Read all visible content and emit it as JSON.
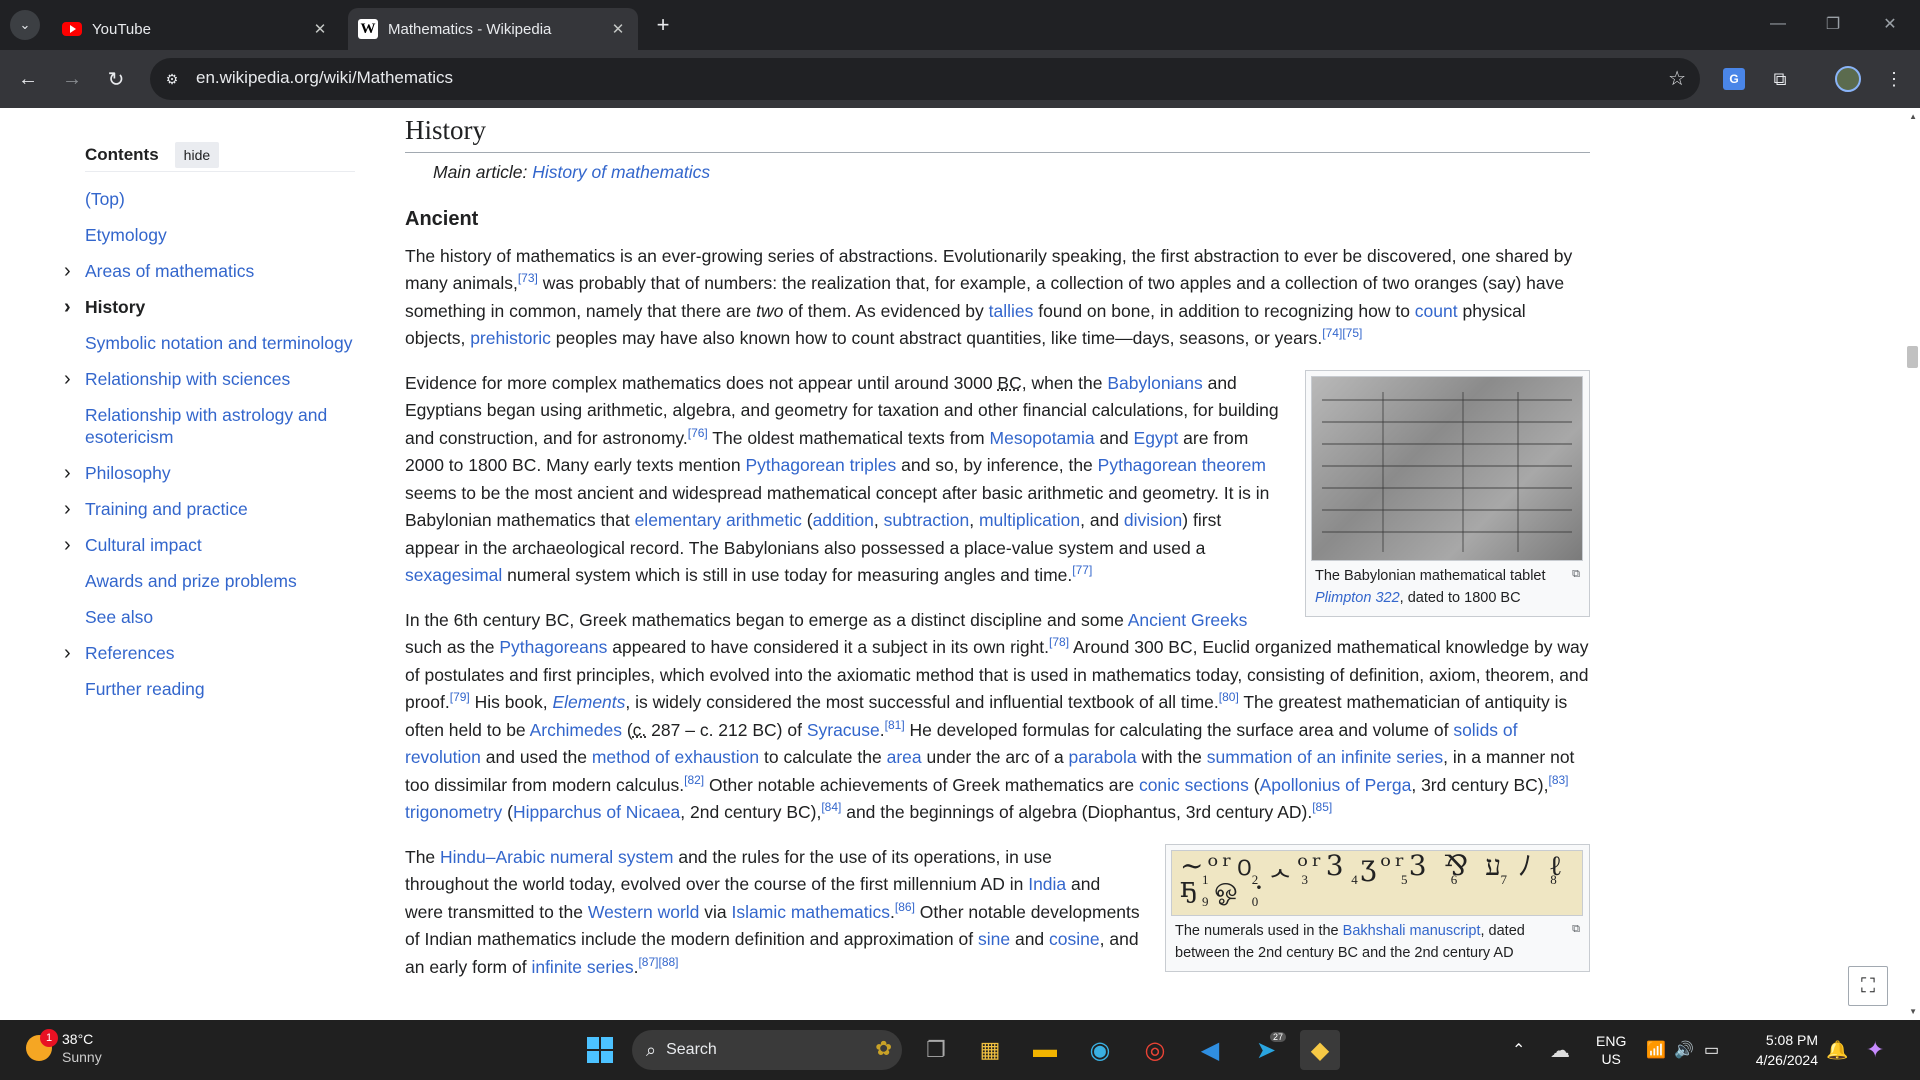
{
  "browser": {
    "tabs": [
      {
        "title": "YouTube",
        "icon": "youtube-icon"
      },
      {
        "title": "Mathematics - Wikipedia",
        "icon": "wikipedia-icon"
      }
    ],
    "url": "en.wikipedia.org/wiki/Mathematics"
  },
  "toc": {
    "title": "Contents",
    "hide_label": "hide",
    "items": [
      {
        "label": "(Top)",
        "expandable": false
      },
      {
        "label": "Etymology",
        "expandable": false
      },
      {
        "label": "Areas of mathematics",
        "expandable": true
      },
      {
        "label": "History",
        "expandable": true,
        "active": true
      },
      {
        "label": "Symbolic notation and terminology",
        "expandable": false
      },
      {
        "label": "Relationship with sciences",
        "expandable": true
      },
      {
        "label": "Relationship with astrology and esotericism",
        "expandable": false
      },
      {
        "label": "Philosophy",
        "expandable": true
      },
      {
        "label": "Training and practice",
        "expandable": true
      },
      {
        "label": "Cultural impact",
        "expandable": true
      },
      {
        "label": "Awards and prize problems",
        "expandable": false
      },
      {
        "label": "See also",
        "expandable": false
      },
      {
        "label": "References",
        "expandable": true
      },
      {
        "label": "Further reading",
        "expandable": false
      }
    ]
  },
  "article": {
    "section_title": "History",
    "main_article_prefix": "Main article: ",
    "main_article_link": "History of mathematics",
    "subsection_title": "Ancient",
    "figure1_caption_pre": "The Babylonian mathematical tablet ",
    "figure1_caption_link": "Plimpton 322",
    "figure1_caption_post": ", dated to 1800 BC",
    "figure2_caption_pre": "The numerals used in the ",
    "figure2_caption_link": "Bakhshali manuscript",
    "figure2_caption_post": ", dated between the 2nd century BC and the 2nd century AD",
    "bakhshali_numbers": "1 2 3 4 5 6 7 8 9 0"
  },
  "taskbar": {
    "weather_temp": "38°C",
    "weather_cond": "Sunny",
    "weather_badge": "1",
    "search_placeholder": "Search",
    "lang1": "ENG",
    "lang2": "US",
    "time": "5:08 PM",
    "date": "4/26/2024",
    "telegram_badge": "27"
  }
}
